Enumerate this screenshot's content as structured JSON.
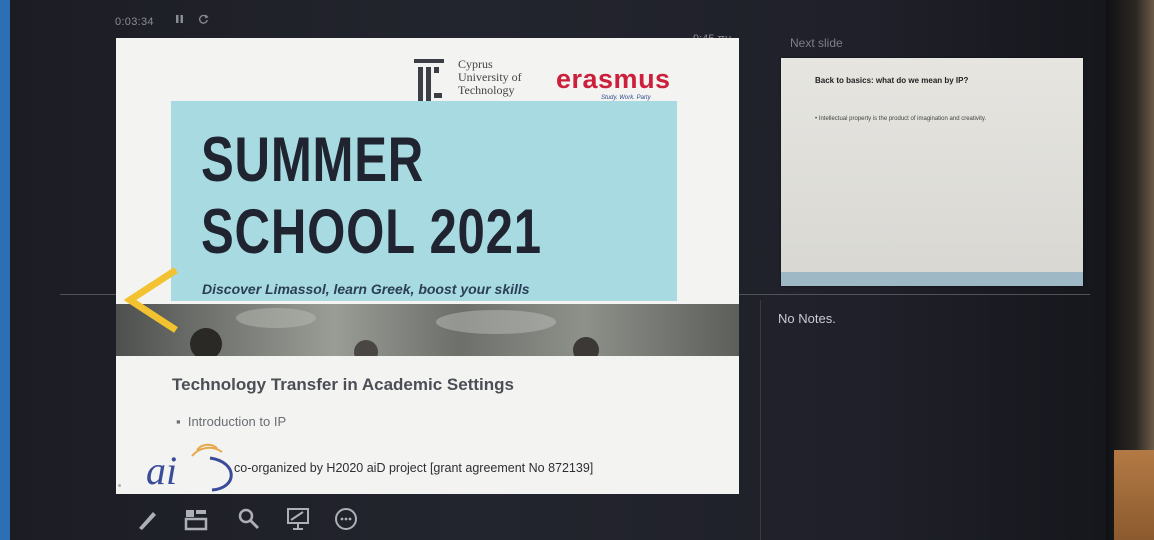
{
  "presenter": {
    "timer": "0:03:34",
    "clock": "9:45 πμ",
    "next_slide_label": "Next slide",
    "notes_text": "No Notes."
  },
  "next_slide": {
    "title": "Back to basics: what do we mean by IP?",
    "bullet": "Intellectual property is the product of imagination and creativity."
  },
  "current_slide": {
    "university_name_line1": "Cyprus",
    "university_name_line2": "University of",
    "university_name_line3": "Technology",
    "erasmus_logo": "erasmus",
    "erasmus_tagline": "Study. Work. Party",
    "title_line1": "SUMMER",
    "title_line2": "SCHOOL 2021",
    "tagline": "Discover Limassol, learn Greek, boost your skills",
    "heading": "Technology Transfer in Academic Settings",
    "bullet": "Introduction to IP",
    "aid_logo": "ai",
    "coorganized": "co-organized by H2020 aiD project [grant agreement No 872139]"
  },
  "toolbar": {
    "icons": [
      "pen-icon",
      "slides-grid-icon",
      "zoom-icon",
      "screen-icon",
      "more-options-icon"
    ]
  },
  "colors": {
    "slide_teal": "#a7dbe1",
    "erasmus_red": "#cc1f3c",
    "arrow_yellow": "#f2c230"
  }
}
